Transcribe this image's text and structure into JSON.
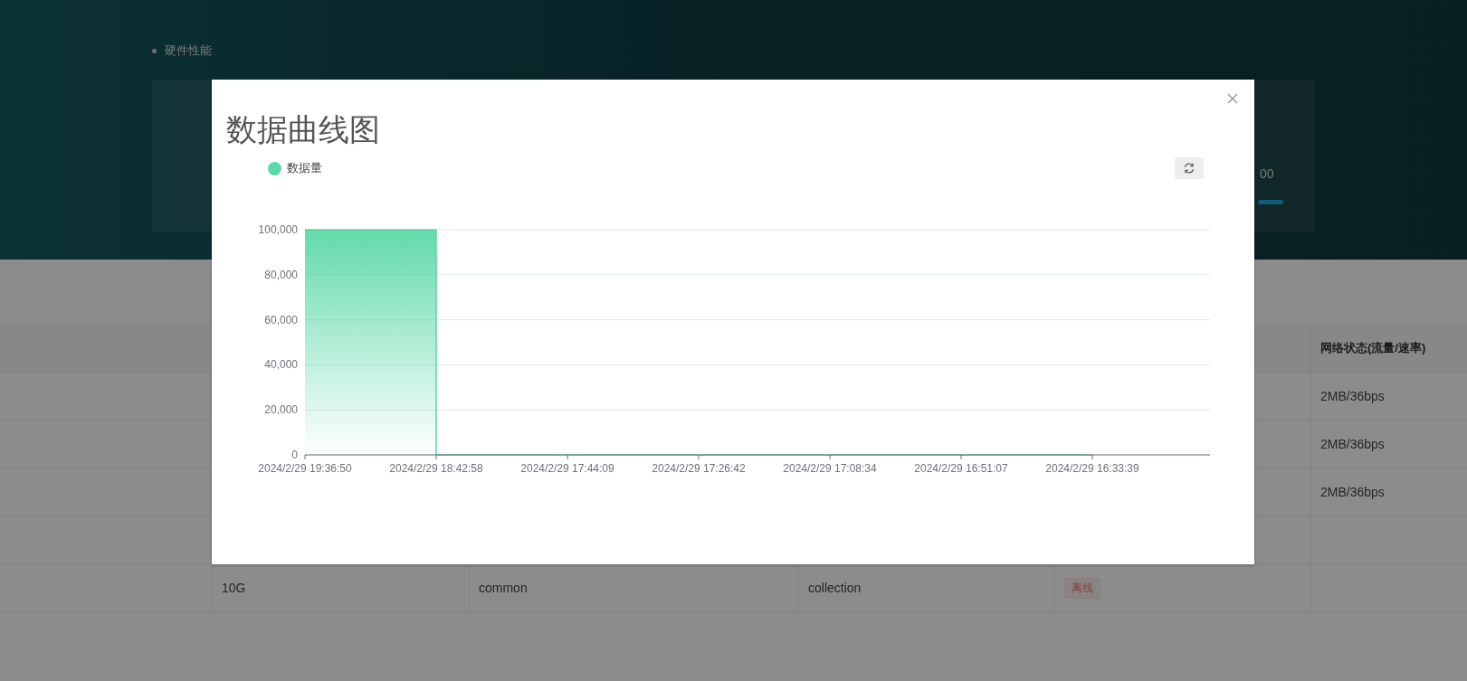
{
  "page": {
    "section_bullet": "硬件性能",
    "panel_value": "00"
  },
  "table": {
    "last_column": "网络状态(流量/速率)",
    "rows": [
      {
        "network": "2MB/36bps"
      },
      {
        "network": "2MB/36bps"
      },
      {
        "network": "2MB/36bps"
      },
      {},
      {
        "column_2": "10G",
        "column_3": "common",
        "column_4": "collection",
        "status": "离线"
      }
    ]
  },
  "dialog": {
    "title": "数据曲线图",
    "chart_data": {
      "type": "area",
      "grid": true,
      "categories": [
        "2024/2/29 19:36:50",
        "2024/2/29 18:42:58",
        "2024/2/29 17:44:09",
        "2024/2/29 17:26:42",
        "2024/2/29 17:08:34",
        "2024/2/29 16:51:07",
        "2024/2/29 16:33:39"
      ],
      "series": [
        {
          "name": "数据量",
          "color": "#5ad8a6",
          "values": [
            100000,
            0,
            0,
            0,
            0,
            0,
            0
          ]
        }
      ],
      "ylim": [
        0,
        100000
      ],
      "yticks": [
        {
          "value": 0,
          "label": "0"
        },
        {
          "value": 20000,
          "label": "20,000"
        },
        {
          "value": 40000,
          "label": "40,000"
        },
        {
          "value": 60000,
          "label": "60,000"
        },
        {
          "value": 80000,
          "label": "80,000"
        },
        {
          "value": 100000,
          "label": "100,000"
        }
      ]
    }
  }
}
